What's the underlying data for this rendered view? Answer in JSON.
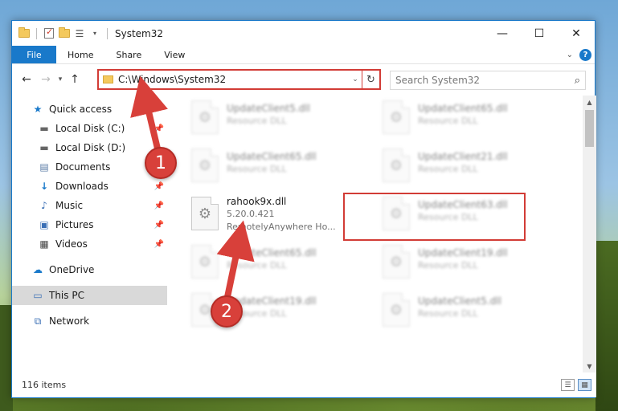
{
  "window": {
    "title": "System32",
    "controls": {
      "minimize": "—",
      "maximize": "☐",
      "close": "✕"
    }
  },
  "ribbon": {
    "tabs": {
      "file": "File",
      "home": "Home",
      "share": "Share",
      "view": "View"
    },
    "help": "?"
  },
  "nav": {
    "address": "C:\\Windows\\System32",
    "search_placeholder": "Search System32"
  },
  "sidebar": {
    "items": [
      {
        "label": "Quick access",
        "icon": "star-icon",
        "pinned": false
      },
      {
        "label": "Local Disk (C:)",
        "icon": "drive-icon",
        "pinned": true
      },
      {
        "label": "Local Disk (D:)",
        "icon": "drive-icon",
        "pinned": false
      },
      {
        "label": "Documents",
        "icon": "documents-icon",
        "pinned": true
      },
      {
        "label": "Downloads",
        "icon": "download-icon",
        "pinned": true
      },
      {
        "label": "Music",
        "icon": "music-icon",
        "pinned": true
      },
      {
        "label": "Pictures",
        "icon": "pictures-icon",
        "pinned": true
      },
      {
        "label": "Videos",
        "icon": "videos-icon",
        "pinned": true
      },
      {
        "label": "OneDrive",
        "icon": "cloud-icon",
        "pinned": false
      },
      {
        "label": "This PC",
        "icon": "computer-icon",
        "pinned": false,
        "selected": true
      },
      {
        "label": "Network",
        "icon": "network-icon",
        "pinned": false
      }
    ]
  },
  "files": [
    {
      "name": "UpdateClient5.dll",
      "sub": "Resource DLL",
      "blurred": true
    },
    {
      "name": "UpdateClient65.dll",
      "sub": "Resource DLL",
      "blurred": true
    },
    {
      "name": "UpdateClient65.dll",
      "sub": "Resource DLL",
      "blurred": true
    },
    {
      "name": "UpdateClient21.dll",
      "sub": "Resource DLL",
      "blurred": true
    },
    {
      "name": "rahook9x.dll",
      "version": "5.20.0.421",
      "sub": "RemotelyAnywhere Ho...",
      "blurred": false,
      "highlighted": true
    },
    {
      "name": "UpdateClient63.dll",
      "sub": "Resource DLL",
      "blurred": true
    },
    {
      "name": "UpdateClient65.dll",
      "sub": "Resource DLL",
      "blurred": true
    },
    {
      "name": "UpdateClient19.dll",
      "sub": "Resource DLL",
      "blurred": true
    },
    {
      "name": "UpdateClient19.dll",
      "sub": "Resource DLL",
      "blurred": true
    },
    {
      "name": "UpdateClient5.dll",
      "sub": "Resource DLL",
      "blurred": true
    }
  ],
  "status": {
    "item_count": "116 items"
  },
  "annotations": {
    "step1": "1",
    "step2": "2"
  },
  "colors": {
    "accent": "#1979ca",
    "highlight_red": "#d23c36",
    "badge_red": "#d8403a"
  }
}
